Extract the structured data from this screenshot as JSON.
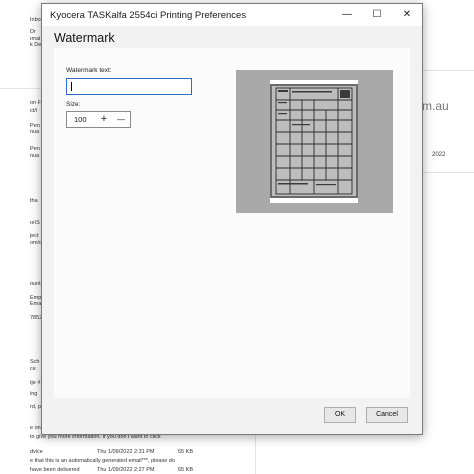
{
  "background_email": {
    "left_fragments": [
      "Inbox",
      "Dr",
      "ımai",
      "k De",
      "on F",
      "ct/l",
      "Pen",
      "nua",
      "Pen",
      "nua",
      "tha",
      "ıe\\S",
      "ject",
      "om/c",
      "ount",
      "Emp",
      "Ema",
      "7852",
      "Sch",
      "ce",
      "tje #",
      "ing",
      "rd, p",
      "e on",
      "to give you more information. If you don't want to click",
      "dvice",
      "e that this is an automatically generated email***, please do",
      "have been delivered",
      "Thu 1/09/2022 2:31 PM",
      "65 KB",
      "Thu 1/09/2022 2:27 PM",
      "65 KB"
    ],
    "right_fragments": [
      "m.au",
      "2022"
    ]
  },
  "dialog": {
    "title": "Kyocera TASKalfa 2554ci Printing Preferences",
    "minimize_glyph": "—",
    "maximize_glyph": "☐",
    "close_glyph": "✕",
    "page_header": "Watermark",
    "watermark_text_label": "Watermark text:",
    "watermark_text_value": "",
    "size_label": "Size:",
    "size_value": "100",
    "increase_glyph": "+",
    "decrease_glyph": "—",
    "ok_label": "OK",
    "cancel_label": "Cancel"
  },
  "colors": {
    "accent": "#2b6cc4",
    "preview_background": "#a9a9a9",
    "dialog_background": "#f2f2f2",
    "content_background": "#fbfbfb"
  }
}
